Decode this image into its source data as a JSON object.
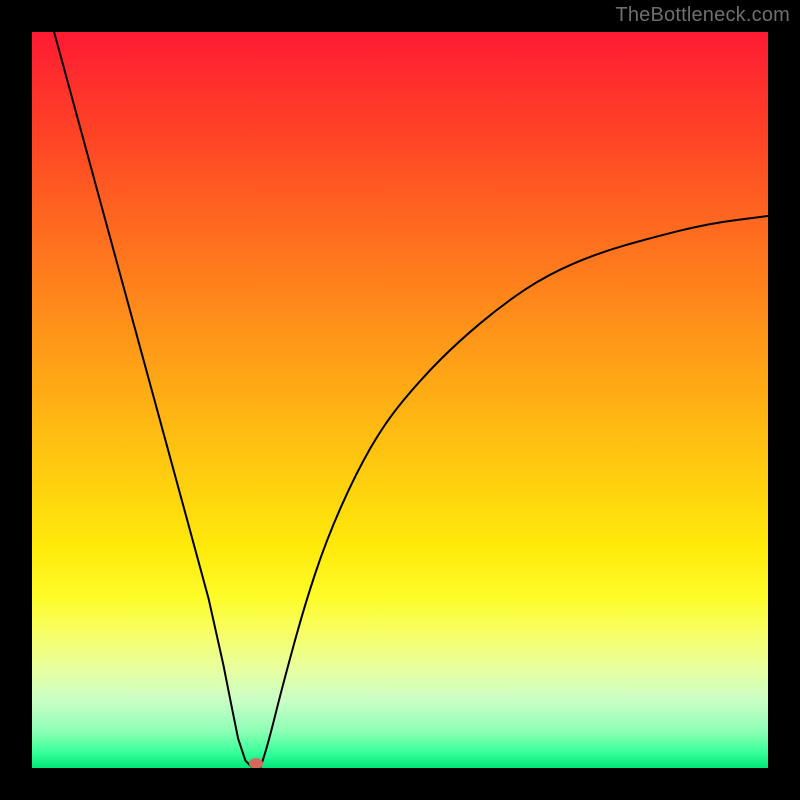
{
  "watermark": "TheBottleneck.com",
  "chart_data": {
    "type": "line",
    "title": "",
    "xlabel": "",
    "ylabel": "",
    "xlim": [
      0,
      100
    ],
    "ylim": [
      0,
      100
    ],
    "grid": false,
    "legend": false,
    "background_gradient": {
      "top_color": "#ff1a33",
      "mid_color": "#ffd20e",
      "bottom_color": "#00e676",
      "note": "vertical gradient from red (top, high bottleneck) through orange/yellow to green (bottom, low bottleneck)"
    },
    "trough": {
      "x": 30,
      "y": 0
    },
    "curve_endpoints": {
      "left_top": {
        "x": 3,
        "y": 100
      },
      "right_end": {
        "x": 100,
        "y": 75
      }
    },
    "series": [
      {
        "name": "bottleneck-curve",
        "color": "#000000",
        "x": [
          3,
          6,
          9,
          12,
          15,
          18,
          21,
          24,
          26,
          27,
          28,
          29,
          30,
          31,
          32,
          34,
          37,
          40,
          44,
          48,
          53,
          58,
          64,
          70,
          77,
          84,
          92,
          100
        ],
        "y": [
          100,
          89,
          78,
          67,
          56,
          45,
          34,
          23,
          14,
          9,
          4,
          1,
          0,
          0,
          3,
          11,
          22,
          31,
          40,
          47,
          53,
          58,
          63,
          67,
          70,
          72,
          74,
          75
        ]
      }
    ],
    "annotations": [
      {
        "type": "marker",
        "name": "trough-point",
        "x": 30.5,
        "y": 0.5,
        "color": "#d46a5e"
      }
    ]
  }
}
